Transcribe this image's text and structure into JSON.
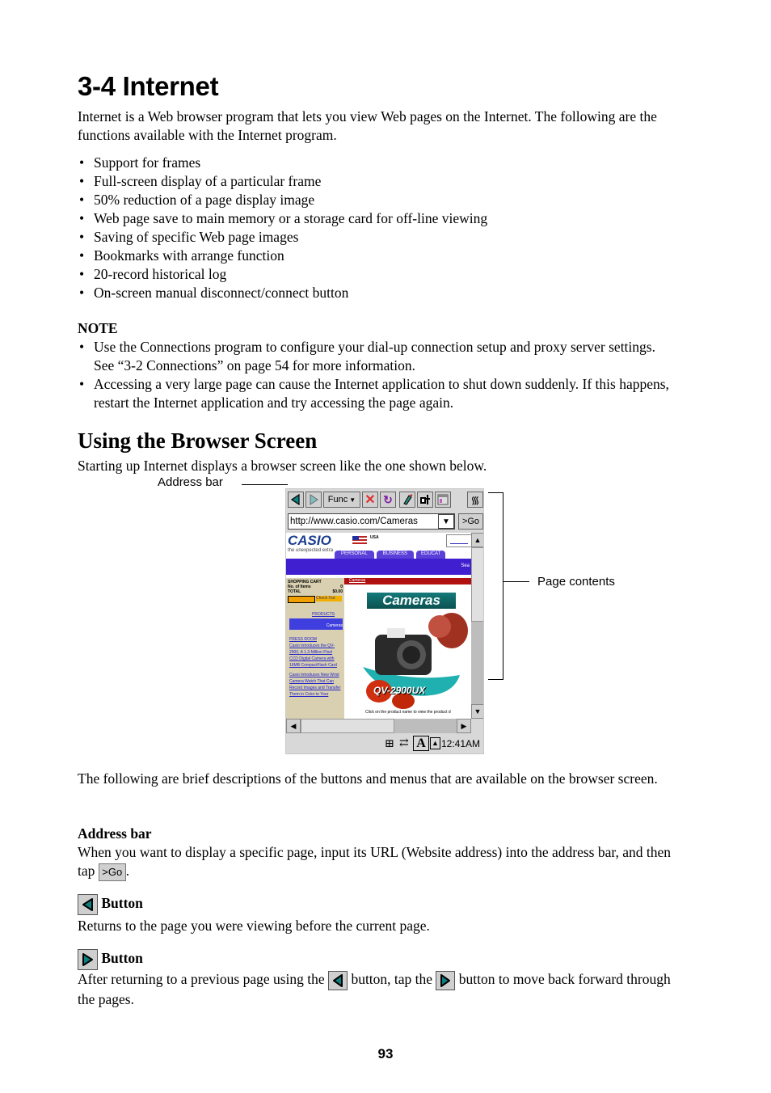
{
  "page": {
    "title": "3-4 Internet",
    "intro": "Internet is a Web browser program that lets you view Web pages on the Internet. The following are the functions available with the Internet program.",
    "features": [
      "Support for frames",
      "Full-screen display of a particular frame",
      "50% reduction of a page display image",
      "Web page save to main memory or a storage card for off-line viewing",
      "Saving of specific Web page images",
      "Bookmarks with arrange function",
      "20-record historical log",
      "On-screen manual disconnect/connect button"
    ],
    "note_heading": "NOTE",
    "notes": [
      "Use the Connections program to configure your dial-up connection setup and proxy server settings. See “3-2 Connections” on page 54 for more information.",
      "Accessing a very large page can cause the Internet application to shut down suddenly. If this happens, restart the Internet application and try accessing the page again."
    ],
    "section_title": "Using the Browser Screen",
    "section_intro": "Starting up Internet displays a browser screen like the one shown below.",
    "callouts": {
      "address_bar": "Address bar",
      "page_contents": "Page contents"
    },
    "desc_intro": "The following are brief descriptions of the buttons and menus that are available on the browser screen.",
    "address_heading": "Address bar",
    "address_text_1": "When you want to display a specific page, input its URL (Website address) into the address bar, and then tap",
    "address_text_2": ".",
    "back_heading": "Button",
    "back_text": "Returns to the page you were viewing before the current page.",
    "fwd_heading": "Button",
    "fwd_text_1": "After returning to a previous page using the",
    "fwd_text_2": "button, tap the",
    "fwd_text_3": "button to move back forward through the pages.",
    "page_number": "93"
  },
  "browser": {
    "toolbar": {
      "func_label": "Func",
      "icons": [
        "back-icon",
        "forward-icon",
        "func-menu",
        "stop-icon",
        "refresh-icon",
        "connect-icon",
        "disconnect-icon",
        "fullscreen-icon",
        "signal-icon"
      ]
    },
    "address_value": "http://www.casio.com/Cameras",
    "go_label": ">Go",
    "site": {
      "logo": "CASIO",
      "tagline": "the unexpected extra",
      "region": "USA",
      "tabs": [
        "PERSONAL",
        "BUSINESS",
        "EDUCAT"
      ],
      "search_label": "Sea",
      "cart_title": "SHOPPING CART",
      "cart_items_label": "No. of Items",
      "cart_items_value": "0",
      "cart_total_label": "TOTAL",
      "cart_total_value": "$0.00",
      "checkout_label": "Check Out",
      "products_link": "PRODUCTS",
      "cameras_link": "Cameras",
      "breadcrumb": "Cameras",
      "banner": "Cameras",
      "model": "QV-2900UX",
      "press_links": [
        "PRESS ROOM",
        "Casio Introduces the QV-2900, A 1.3-Million Pixel CCD Digital Camera with 16MB CompactFlash Card",
        "Casio Introduces New Wrist Camera Watch That Can Record Images and Transfer Them in Color to Your"
      ],
      "footer_text": "Click on the product name to view the product d"
    },
    "status": {
      "time": "12:41AM",
      "input_mode": "A"
    },
    "colors": {
      "casio_blue": "#1a3d8f",
      "nav_purple": "#3f1fd0",
      "crumb_red": "#b01010",
      "link_blue": "#2222cc",
      "sidebar_tan": "#d8d0b0",
      "teal_icon": "#0e7f7f"
    }
  }
}
